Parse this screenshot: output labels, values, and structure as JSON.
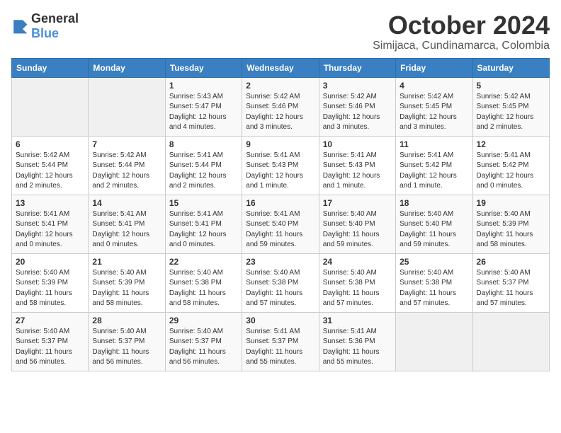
{
  "logo": {
    "general": "General",
    "blue": "Blue"
  },
  "title": "October 2024",
  "location": "Simijaca, Cundinamarca, Colombia",
  "days_of_week": [
    "Sunday",
    "Monday",
    "Tuesday",
    "Wednesday",
    "Thursday",
    "Friday",
    "Saturday"
  ],
  "weeks": [
    [
      {
        "day": "",
        "sunrise": "",
        "sunset": "",
        "daylight": "",
        "empty": true
      },
      {
        "day": "",
        "sunrise": "",
        "sunset": "",
        "daylight": "",
        "empty": true
      },
      {
        "day": "1",
        "sunrise": "Sunrise: 5:43 AM",
        "sunset": "Sunset: 5:47 PM",
        "daylight": "Daylight: 12 hours and 4 minutes."
      },
      {
        "day": "2",
        "sunrise": "Sunrise: 5:42 AM",
        "sunset": "Sunset: 5:46 PM",
        "daylight": "Daylight: 12 hours and 3 minutes."
      },
      {
        "day": "3",
        "sunrise": "Sunrise: 5:42 AM",
        "sunset": "Sunset: 5:46 PM",
        "daylight": "Daylight: 12 hours and 3 minutes."
      },
      {
        "day": "4",
        "sunrise": "Sunrise: 5:42 AM",
        "sunset": "Sunset: 5:45 PM",
        "daylight": "Daylight: 12 hours and 3 minutes."
      },
      {
        "day": "5",
        "sunrise": "Sunrise: 5:42 AM",
        "sunset": "Sunset: 5:45 PM",
        "daylight": "Daylight: 12 hours and 2 minutes."
      }
    ],
    [
      {
        "day": "6",
        "sunrise": "Sunrise: 5:42 AM",
        "sunset": "Sunset: 5:44 PM",
        "daylight": "Daylight: 12 hours and 2 minutes."
      },
      {
        "day": "7",
        "sunrise": "Sunrise: 5:42 AM",
        "sunset": "Sunset: 5:44 PM",
        "daylight": "Daylight: 12 hours and 2 minutes."
      },
      {
        "day": "8",
        "sunrise": "Sunrise: 5:41 AM",
        "sunset": "Sunset: 5:44 PM",
        "daylight": "Daylight: 12 hours and 2 minutes."
      },
      {
        "day": "9",
        "sunrise": "Sunrise: 5:41 AM",
        "sunset": "Sunset: 5:43 PM",
        "daylight": "Daylight: 12 hours and 1 minute."
      },
      {
        "day": "10",
        "sunrise": "Sunrise: 5:41 AM",
        "sunset": "Sunset: 5:43 PM",
        "daylight": "Daylight: 12 hours and 1 minute."
      },
      {
        "day": "11",
        "sunrise": "Sunrise: 5:41 AM",
        "sunset": "Sunset: 5:42 PM",
        "daylight": "Daylight: 12 hours and 1 minute."
      },
      {
        "day": "12",
        "sunrise": "Sunrise: 5:41 AM",
        "sunset": "Sunset: 5:42 PM",
        "daylight": "Daylight: 12 hours and 0 minutes."
      }
    ],
    [
      {
        "day": "13",
        "sunrise": "Sunrise: 5:41 AM",
        "sunset": "Sunset: 5:41 PM",
        "daylight": "Daylight: 12 hours and 0 minutes."
      },
      {
        "day": "14",
        "sunrise": "Sunrise: 5:41 AM",
        "sunset": "Sunset: 5:41 PM",
        "daylight": "Daylight: 12 hours and 0 minutes."
      },
      {
        "day": "15",
        "sunrise": "Sunrise: 5:41 AM",
        "sunset": "Sunset: 5:41 PM",
        "daylight": "Daylight: 12 hours and 0 minutes."
      },
      {
        "day": "16",
        "sunrise": "Sunrise: 5:41 AM",
        "sunset": "Sunset: 5:40 PM",
        "daylight": "Daylight: 11 hours and 59 minutes."
      },
      {
        "day": "17",
        "sunrise": "Sunrise: 5:40 AM",
        "sunset": "Sunset: 5:40 PM",
        "daylight": "Daylight: 11 hours and 59 minutes."
      },
      {
        "day": "18",
        "sunrise": "Sunrise: 5:40 AM",
        "sunset": "Sunset: 5:40 PM",
        "daylight": "Daylight: 11 hours and 59 minutes."
      },
      {
        "day": "19",
        "sunrise": "Sunrise: 5:40 AM",
        "sunset": "Sunset: 5:39 PM",
        "daylight": "Daylight: 11 hours and 58 minutes."
      }
    ],
    [
      {
        "day": "20",
        "sunrise": "Sunrise: 5:40 AM",
        "sunset": "Sunset: 5:39 PM",
        "daylight": "Daylight: 11 hours and 58 minutes."
      },
      {
        "day": "21",
        "sunrise": "Sunrise: 5:40 AM",
        "sunset": "Sunset: 5:39 PM",
        "daylight": "Daylight: 11 hours and 58 minutes."
      },
      {
        "day": "22",
        "sunrise": "Sunrise: 5:40 AM",
        "sunset": "Sunset: 5:38 PM",
        "daylight": "Daylight: 11 hours and 58 minutes."
      },
      {
        "day": "23",
        "sunrise": "Sunrise: 5:40 AM",
        "sunset": "Sunset: 5:38 PM",
        "daylight": "Daylight: 11 hours and 57 minutes."
      },
      {
        "day": "24",
        "sunrise": "Sunrise: 5:40 AM",
        "sunset": "Sunset: 5:38 PM",
        "daylight": "Daylight: 11 hours and 57 minutes."
      },
      {
        "day": "25",
        "sunrise": "Sunrise: 5:40 AM",
        "sunset": "Sunset: 5:38 PM",
        "daylight": "Daylight: 11 hours and 57 minutes."
      },
      {
        "day": "26",
        "sunrise": "Sunrise: 5:40 AM",
        "sunset": "Sunset: 5:37 PM",
        "daylight": "Daylight: 11 hours and 57 minutes."
      }
    ],
    [
      {
        "day": "27",
        "sunrise": "Sunrise: 5:40 AM",
        "sunset": "Sunset: 5:37 PM",
        "daylight": "Daylight: 11 hours and 56 minutes."
      },
      {
        "day": "28",
        "sunrise": "Sunrise: 5:40 AM",
        "sunset": "Sunset: 5:37 PM",
        "daylight": "Daylight: 11 hours and 56 minutes."
      },
      {
        "day": "29",
        "sunrise": "Sunrise: 5:40 AM",
        "sunset": "Sunset: 5:37 PM",
        "daylight": "Daylight: 11 hours and 56 minutes."
      },
      {
        "day": "30",
        "sunrise": "Sunrise: 5:41 AM",
        "sunset": "Sunset: 5:37 PM",
        "daylight": "Daylight: 11 hours and 55 minutes."
      },
      {
        "day": "31",
        "sunrise": "Sunrise: 5:41 AM",
        "sunset": "Sunset: 5:36 PM",
        "daylight": "Daylight: 11 hours and 55 minutes."
      },
      {
        "day": "",
        "sunrise": "",
        "sunset": "",
        "daylight": "",
        "empty": true
      },
      {
        "day": "",
        "sunrise": "",
        "sunset": "",
        "daylight": "",
        "empty": true
      }
    ]
  ]
}
